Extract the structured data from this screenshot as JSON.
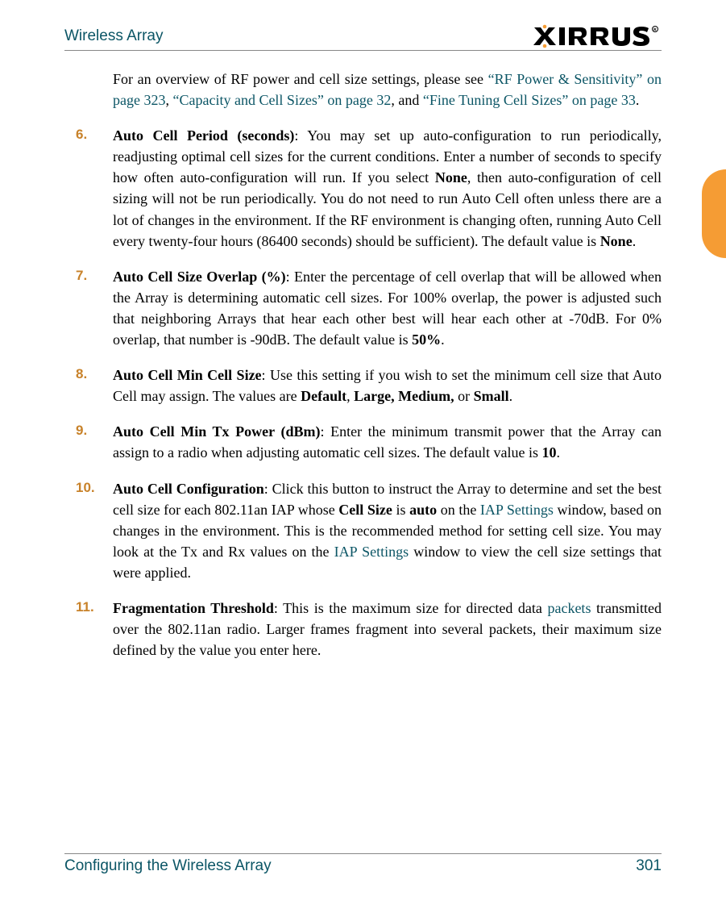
{
  "header": {
    "title": "Wireless Array",
    "brand": "XIRRUS"
  },
  "intro": {
    "lead": "For an overview of RF power and cell size settings, please see ",
    "link1": "“RF Power & Sensitivity” on page 323",
    "sep1": ", ",
    "link2": "“Capacity and Cell Sizes” on page 32",
    "sep2": ", and ",
    "link3": "“Fine Tuning Cell Sizes” on page 33",
    "end": ". "
  },
  "items": {
    "i6": {
      "num": "6.",
      "title": "Auto Cell Period (seconds)",
      "t1": ": You may set up auto-configuration to run periodically, readjusting optimal cell sizes for the current conditions. Enter a number of seconds to specify how often auto-configuration will run. If you select ",
      "none1": "None",
      "t2": ", then auto-configuration of cell sizing will not be run periodically. You do not need to run Auto Cell often unless there are a lot of changes in the environment. If the RF environment is changing often, running Auto Cell every twenty-four hours (86400 seconds) should be sufficient). The default value is ",
      "none2": "None",
      "t3": "."
    },
    "i7": {
      "num": "7.",
      "title": "Auto Cell Size Overlap (%)",
      "t1": ": Enter the percentage of cell overlap that will be allowed when the Array is determining automatic cell sizes. For 100% overlap, the power is adjusted such that neighboring Arrays that hear each other best will hear each other at -70dB. For 0% overlap, that number is -90dB. The default value is ",
      "val": "50%",
      "t2": "."
    },
    "i8": {
      "num": "8.",
      "title": "Auto Cell Min Cell Size",
      "t1": ": Use this setting if you wish to set the minimum cell size that Auto Cell may assign. The values are ",
      "v1": "Default",
      "s1": ", ",
      "v2": "Large, Medium,",
      "s2": " or ",
      "v3": "Small",
      "t2": "."
    },
    "i9": {
      "num": "9.",
      "title": "Auto Cell Min Tx Power (dBm)",
      "t1": ": Enter the minimum transmit power that the Array can assign to a radio when adjusting automatic cell sizes. The default value is ",
      "val": "10",
      "t2": "."
    },
    "i10": {
      "num": "10.",
      "title": "Auto Cell Configuration",
      "t1": ": Click this button to instruct the Array to determine and set the best cell size for each 802.11an IAP whose ",
      "b1": "Cell Size",
      "t2": " is ",
      "b2": "auto",
      "t3": " on the ",
      "link1": "IAP Settings",
      "t4": " window, based on changes in the environment. This is the recommended method for setting cell size. You may look at the Tx and Rx values on the ",
      "link2": "IAP Settings",
      "t5": " window to view the cell size settings that were applied."
    },
    "i11": {
      "num": "11.",
      "title": "Fragmentation Threshold",
      "t1": ": This is the maximum size for directed data ",
      "link1": "packets",
      "t2": " transmitted over the 802.11an radio. Larger frames fragment into several packets, their maximum size defined by the value you enter here."
    }
  },
  "footer": {
    "section": "Configuring the Wireless Array",
    "page": "301"
  }
}
